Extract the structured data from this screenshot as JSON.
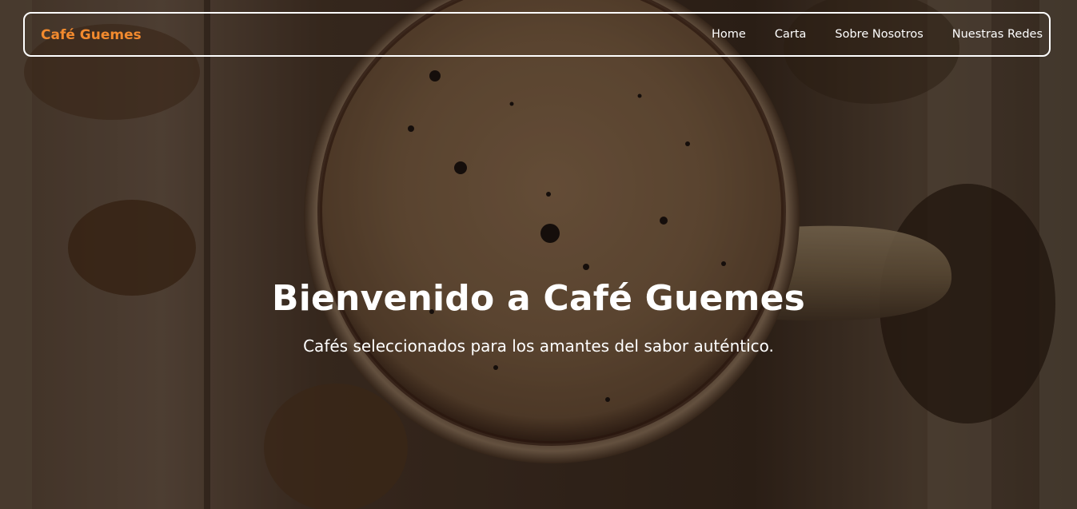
{
  "header": {
    "brand": "Café Guemes",
    "nav": [
      {
        "label": "Home"
      },
      {
        "label": "Carta"
      },
      {
        "label": "Sobre Nosotros"
      },
      {
        "label": "Nuestras Redes"
      }
    ]
  },
  "hero": {
    "title": "Bienvenido a Café Guemes",
    "subtitle": "Cafés seleccionados para los amantes del sabor auténtico.",
    "background": "coffee-cup-photo"
  },
  "colors": {
    "brand_accent": "#f28a2e",
    "text": "#ffffff",
    "overlay": "#000000"
  }
}
